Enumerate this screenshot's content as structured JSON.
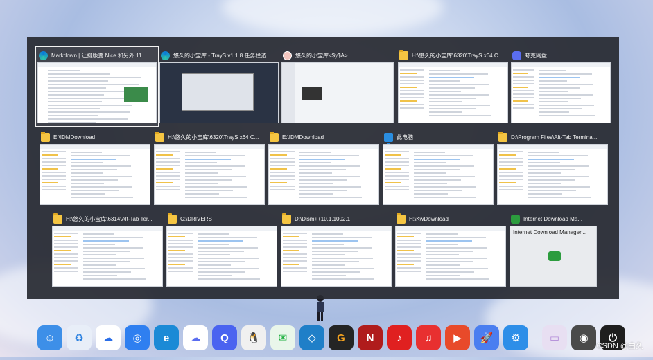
{
  "switcher": {
    "rows": [
      [
        {
          "title": "Markdown | 让排版变 Nice 和另外 11...",
          "icon": "edge-icon",
          "selected": true,
          "thumb": "doc"
        },
        {
          "title": "悠久的小宝库 - TrayS v1.1.8 任务栏透...",
          "icon": "edge-icon",
          "selected": false,
          "thumb": "dark"
        },
        {
          "title": "悠久的小宝库<$y$A>",
          "icon": "avatar-icon",
          "selected": false,
          "thumb": "chat"
        },
        {
          "title": "H:\\悠久的小宝库\\6320\\TrayS x64 C...",
          "icon": "folder-icon",
          "selected": false,
          "thumb": "explorer"
        },
        {
          "title": "夸克网盘",
          "icon": "cloud-icon",
          "selected": false,
          "thumb": "cloud"
        }
      ],
      [
        {
          "title": "E:\\IDMDownload",
          "icon": "folder-icon",
          "selected": false,
          "thumb": "explorer"
        },
        {
          "title": "H:\\悠久的小宝库\\6320\\TrayS x64 C...",
          "icon": "folder-icon",
          "selected": false,
          "thumb": "explorer"
        },
        {
          "title": "E:\\IDMDownload",
          "icon": "folder-icon",
          "selected": false,
          "thumb": "explorer"
        },
        {
          "title": "此电脑",
          "icon": "pc-icon",
          "selected": false,
          "thumb": "pc"
        },
        {
          "title": "D:\\Program Files\\Alt-Tab Termina...",
          "icon": "folder-icon",
          "selected": false,
          "thumb": "explorer"
        }
      ],
      [
        {
          "title": "H:\\悠久的小宝库\\6314\\Alt-Tab Ter...",
          "icon": "folder-icon",
          "selected": false,
          "thumb": "explorer"
        },
        {
          "title": "C:\\DRIVERS",
          "icon": "folder-icon",
          "selected": false,
          "thumb": "explorer"
        },
        {
          "title": "D:\\Dism++10.1.1002.1",
          "icon": "folder-icon",
          "selected": false,
          "thumb": "explorer"
        },
        {
          "title": "H:\\KwDownload",
          "icon": "folder-icon",
          "selected": false,
          "thumb": "explorer"
        },
        {
          "title": "Internet Download Ma...",
          "icon": "idm-icon",
          "selected": false,
          "thumb": "idm",
          "thumb_text": "Internet Download Manager..."
        }
      ]
    ]
  },
  "dock": {
    "apps": [
      {
        "name": "finder-app",
        "color": "#3d8fe8",
        "glyph": "☺"
      },
      {
        "name": "recycle-bin-app",
        "color": "#e8eef8",
        "glyph": "♻",
        "fg": "#2a80e0"
      },
      {
        "name": "baidu-netdisk-app",
        "color": "#ffffff",
        "glyph": "☁",
        "fg": "#2a6ee8"
      },
      {
        "name": "browser-app",
        "color": "#2f7ff0",
        "glyph": "◎"
      },
      {
        "name": "edge-app",
        "color": "#1b8ad6",
        "glyph": "e"
      },
      {
        "name": "quark-cloud-app",
        "color": "#ffffff",
        "glyph": "☁",
        "fg": "#5a6df0"
      },
      {
        "name": "quark-browser-app",
        "color": "#4a63f0",
        "glyph": "Q"
      },
      {
        "name": "qq-app",
        "color": "#f0f0f0",
        "glyph": "🐧",
        "fg": "#111"
      },
      {
        "name": "wechat-app",
        "color": "#e9f6ea",
        "glyph": "✉",
        "fg": "#20b040"
      },
      {
        "name": "virtualbox-app",
        "color": "#1f7fc8",
        "glyph": "◇"
      },
      {
        "name": "steam-like-app",
        "color": "#242424",
        "glyph": "G",
        "fg": "#f0a020"
      },
      {
        "name": "naraka-app",
        "color": "#b01c1c",
        "glyph": "N"
      },
      {
        "name": "netease-music-app",
        "color": "#e02020",
        "glyph": "♪"
      },
      {
        "name": "music-app",
        "color": "#e83030",
        "glyph": "♫"
      },
      {
        "name": "xunlei-app",
        "color": "#e84a2a",
        "glyph": "▶"
      },
      {
        "name": "rocket-app",
        "color": "#4a7ef0",
        "glyph": "🚀"
      },
      {
        "name": "settings-app",
        "color": "#2d8ee8",
        "glyph": "⚙"
      },
      {
        "name": "folder-app",
        "color": "#e8dff2",
        "glyph": "▭",
        "fg": "#b28ad8"
      },
      {
        "name": "disk-app",
        "color": "#4a4a4a",
        "glyph": "◉"
      },
      {
        "name": "power-app",
        "color": "#1e1e1e",
        "glyph": "⏻"
      }
    ],
    "separator_after": 16
  },
  "watermark": "CSDN @由久"
}
